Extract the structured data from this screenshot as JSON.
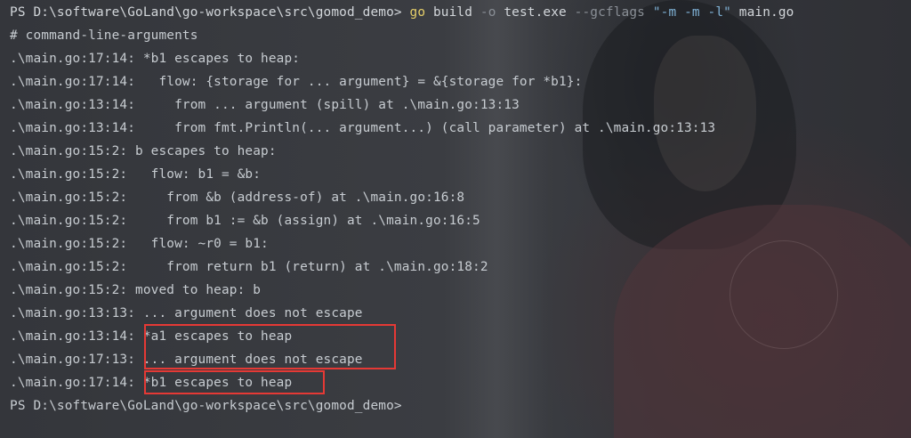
{
  "prompt": {
    "path": "PS D:\\software\\GoLand\\go-workspace\\src\\gomod_demo>",
    "cmd_go": "go",
    "cmd_build": " build ",
    "flag_o": "-o",
    "cmd_exe": " test.exe ",
    "flag_gcflags": "--gcflags",
    "cmd_space": " ",
    "flag_value": "\"-m -m -l\"",
    "cmd_file": " main.go"
  },
  "output_lines": [
    "# command-line-arguments",
    ".\\main.go:17:14: *b1 escapes to heap:",
    ".\\main.go:17:14:   flow: {storage for ... argument} = &{storage for *b1}:",
    ".\\main.go:13:14:     from ... argument (spill) at .\\main.go:13:13",
    ".\\main.go:13:14:     from fmt.Println(... argument...) (call parameter) at .\\main.go:13:13",
    ".\\main.go:15:2: b escapes to heap:",
    ".\\main.go:15:2:   flow: b1 = &b:",
    ".\\main.go:15:2:     from &b (address-of) at .\\main.go:16:8",
    ".\\main.go:15:2:     from b1 := &b (assign) at .\\main.go:16:5",
    ".\\main.go:15:2:   flow: ~r0 = b1:",
    ".\\main.go:15:2:     from return b1 (return) at .\\main.go:18:2",
    ".\\main.go:15:2: moved to heap: b",
    ".\\main.go:13:13: ... argument does not escape",
    ".\\main.go:13:14: *a1 escapes to heap",
    ".\\main.go:17:13: ... argument does not escape",
    ".\\main.go:17:14: *b1 escapes to heap"
  ],
  "final_prompt": "PS D:\\software\\GoLand\\go-workspace\\src\\gomod_demo>",
  "colors": {
    "text": "#c7ccd1",
    "go_keyword": "#e6cf69",
    "flag": "#8a8f96",
    "string": "#7fb2d6",
    "highlight_border": "#e53935"
  }
}
